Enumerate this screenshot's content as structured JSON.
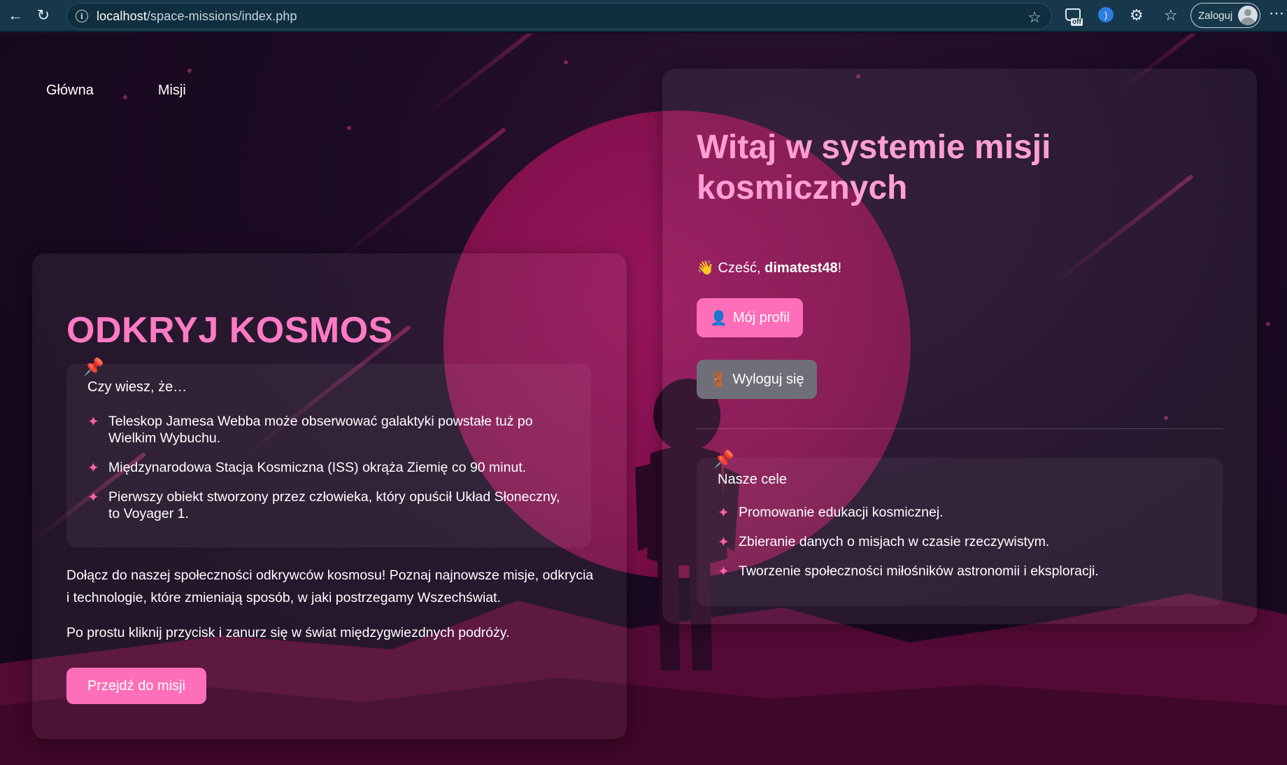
{
  "browser": {
    "url_host": "localhost",
    "url_path": "/space-missions/index.php",
    "ext_off_badge": "off",
    "login_label": "Zaloguj"
  },
  "nav": {
    "items": [
      "Główna",
      "Misji"
    ]
  },
  "left": {
    "title": "ODKRYJ KOSMOS",
    "facts_title": "Czy wiesz, że…",
    "facts": [
      "Teleskop Jamesa Webba może obserwować galaktyki powstałe tuż po Wielkim Wybuchu.",
      "Międzynarodowa Stacja Kosmiczna (ISS) okrąża Ziemię co 90 minut.",
      "Pierwszy obiekt stworzony przez człowieka, który opuścił Układ Słoneczny, to Voyager 1."
    ],
    "intro_1": "Dołącz do naszej społeczności odkrywców kosmosu! Poznaj najnowsze misje, odkrycia i technologie, które zmieniają sposób, w jaki postrzegamy Wszechświat.",
    "intro_2": "Po prostu kliknij przycisk i zanurz się w świat międzygwiezdnych podróży.",
    "cta_label": "Przejdź do misji"
  },
  "right": {
    "title": "Witaj w systemie misji kosmicznych",
    "greeting_prefix": "Cześć, ",
    "username": "dimatest48",
    "greeting_suffix": "!",
    "profile_label": "Mój profil",
    "logout_label": "Wyloguj się",
    "goals_title": "Nasze cele",
    "goals": [
      "Promowanie edukacji kosmicznej.",
      "Zbieranie danych o misjach w czasie rzeczywistym.",
      "Tworzenie społeczności miłośników astronomii i eksploracji."
    ]
  },
  "colors": {
    "accent_pink": "#ff6eb8",
    "title_pink": "#ff7ac4",
    "welcome_pink": "#ff9fd4",
    "logout_grey": "#6e6f78",
    "chrome_bg": "#16384a"
  },
  "icons": {
    "back": "arrow-left-icon",
    "reload": "reload-icon",
    "info": "info-icon",
    "bookmark": "star-icon",
    "pin": "pushpin-icon",
    "sparkle": "sparkle-icon",
    "wave": "waving-hand-icon",
    "profile": "user-icon",
    "logout": "door-icon"
  }
}
